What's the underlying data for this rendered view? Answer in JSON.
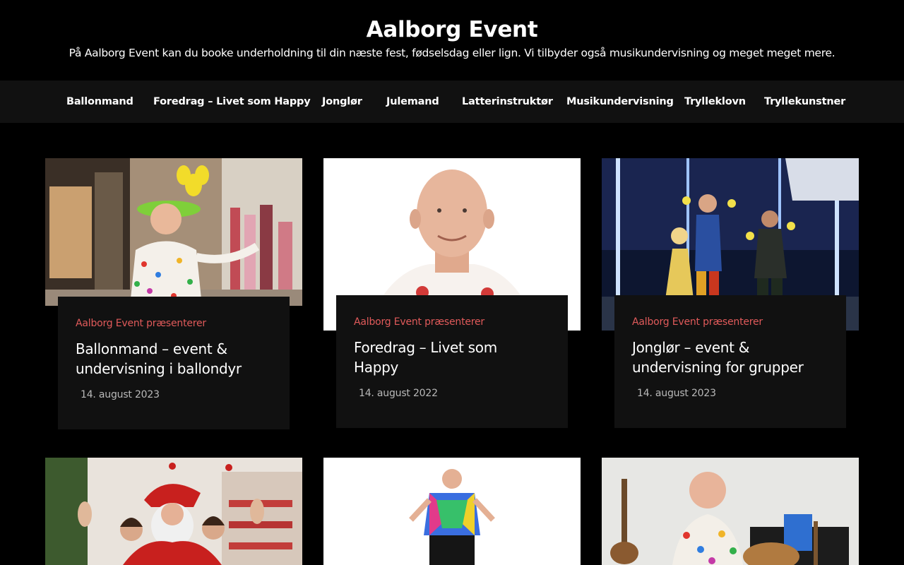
{
  "header": {
    "site_title": "Aalborg Event",
    "tagline": "På Aalborg Event kan du booke underholdning til din næste fest, fødselsdag eller lign. Vi tilbyder også musikundervisning og meget meget mere."
  },
  "nav": {
    "items": [
      {
        "label": "Ballonmand"
      },
      {
        "label": "Foredrag – Livet som Happy"
      },
      {
        "label": "Jonglør"
      },
      {
        "label": "Julemand"
      },
      {
        "label": "Latterinstruktør"
      },
      {
        "label": "Musikundervisning"
      },
      {
        "label": "Trylleklovn"
      },
      {
        "label": "Tryllekunstner"
      }
    ]
  },
  "posts": [
    {
      "category": "Aalborg Event præsenterer",
      "title": "Ballonmand – event & undervisning i ballondyr",
      "date": "14. august 2023"
    },
    {
      "category": "Aalborg Event præsenterer",
      "title": "Foredrag – Livet som Happy",
      "date": "14. august 2022"
    },
    {
      "category": "Aalborg Event præsenterer",
      "title": "Jonglør – event & undervisning for grupper",
      "date": "14. august 2023"
    }
  ],
  "colors": {
    "background": "#000000",
    "nav_background": "#111111",
    "card_background": "#111111",
    "accent": "#e05a5a",
    "date_text": "#b9b9b9"
  }
}
